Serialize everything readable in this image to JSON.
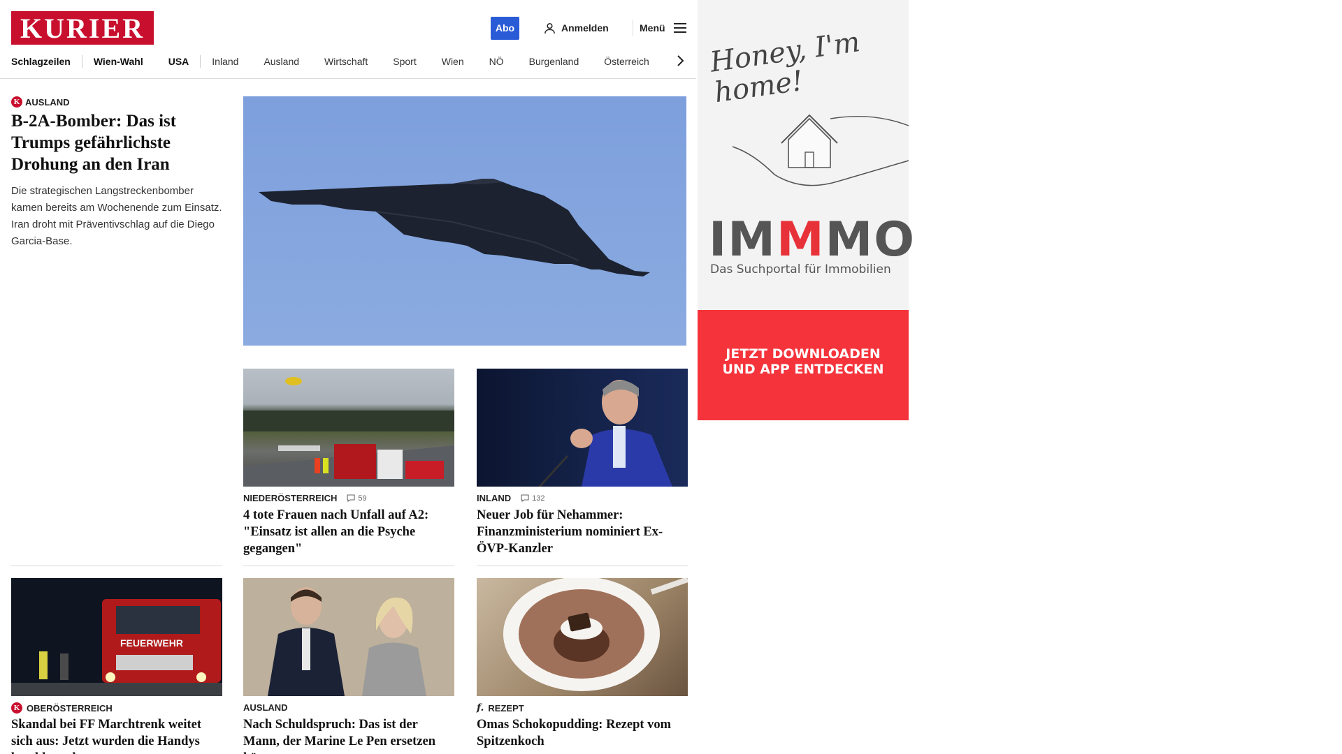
{
  "header": {
    "logo": "KURIER",
    "abo_label": "Abo",
    "login_label": "Anmelden",
    "menu_label": "Menü"
  },
  "nav": {
    "items": [
      "Schlagzeilen",
      "Wien-Wahl",
      "USA",
      "Inland",
      "Ausland",
      "Wirtschaft",
      "Sport",
      "Wien",
      "NÖ",
      "Burgenland",
      "Österreich"
    ]
  },
  "lead": {
    "category": "AUSLAND",
    "title": "B-2A-Bomber: Das ist Trumps gefährlichste Drohung an den Iran",
    "teaser": "Die strategischen Langstreckenbomber kamen bereits am Wochenende zum Einsatz. Iran droht mit Präventivschlag auf die Diego Garcia-Base."
  },
  "cards": [
    {
      "category": "NIEDERÖSTERREICH",
      "comments": "59",
      "title": "4 tote Frauen nach Unfall auf A2: \"Einsatz ist allen an die Psyche gegangen\""
    },
    {
      "category": "INLAND",
      "comments": "132",
      "title": "Neuer Job für Nehammer: Finanzministerium nominiert Ex-ÖVP-Kanzler"
    },
    {
      "category": "OBERÖSTERREICH",
      "title": "Skandal bei FF Marchtrenk weitet sich aus: Jetzt wurden die Handys beschlagnahmt"
    },
    {
      "category": "AUSLAND",
      "title": "Nach Schuldspruch: Das ist der Mann, der Marine Le Pen ersetzen könnte"
    },
    {
      "category": "REZEPT",
      "title": "Omas Schokopudding: Rezept vom Spitzenkoch"
    }
  ],
  "ad": {
    "script": "Honey, I'm home!",
    "brand_a": "IM",
    "brand_b": "M",
    "brand_c": "MO",
    "subtitle": "Das Suchportal für Immobilien",
    "cta_line1": "JETZT DOWNLOADEN",
    "cta_line2": "UND APP ENTDECKEN",
    "truck_text": "FEUERWEHR"
  },
  "colors": {
    "brand_red": "#c8102e",
    "abo_blue": "#2a5bd7",
    "ad_red": "#f5333b"
  }
}
